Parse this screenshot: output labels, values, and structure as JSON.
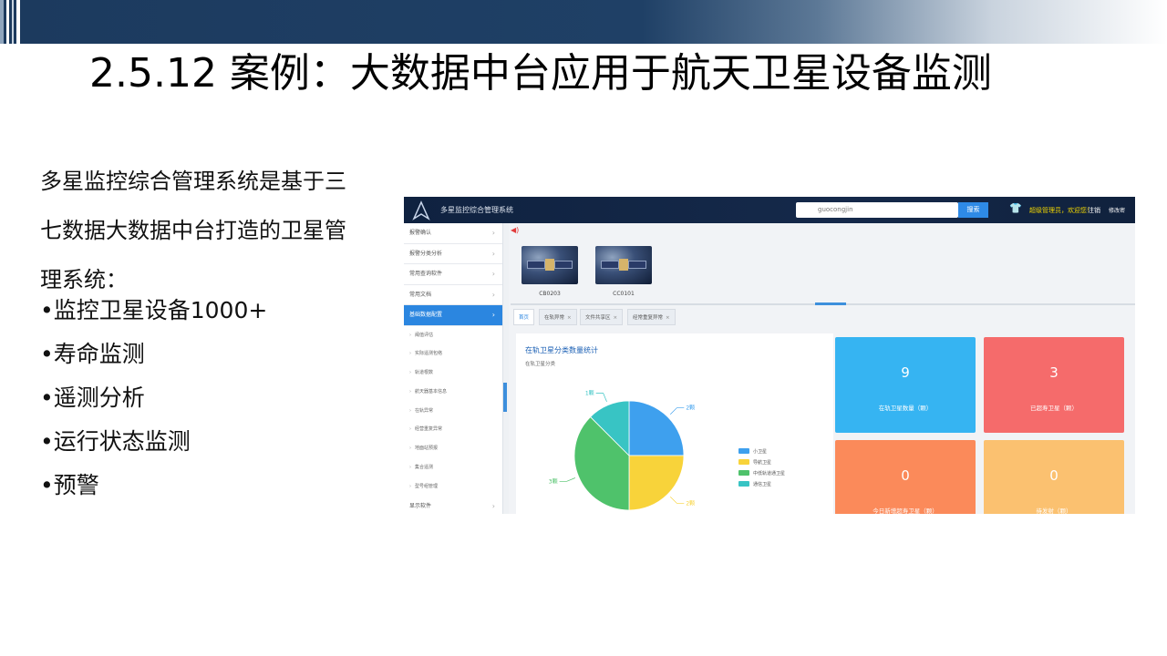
{
  "slide": {
    "title": "2.5.12 案例：大数据中台应用于航天卫星设备监测",
    "intro_lines": [
      "多星监控综合管理系统是基于三",
      "七数据大数据中台打造的卫星管",
      "理系统："
    ],
    "bullets": [
      "•监控卫星设备1000+",
      "•寿命监测",
      "•遥测分析",
      "•运行状态监测",
      "•预警"
    ]
  },
  "app": {
    "name": "多星监控综合管理系统",
    "search": {
      "value": "guocongjin",
      "button": "搜索"
    },
    "welcome": "超级管理员，欢迎您！",
    "logout": "注销",
    "extra": "修改密",
    "sidebar": {
      "items_top": [
        {
          "label": "报警确认"
        },
        {
          "label": "报警分类分析"
        },
        {
          "label": "常用查询软件"
        },
        {
          "label": "常用文档"
        }
      ],
      "active_item": {
        "label": "基础数据配置"
      },
      "sub_items": [
        "阈值评估",
        "实际遥测包络",
        "轨道根数",
        "航天器基本信息",
        "在轨异常",
        "经营重复异常",
        "地面站预报",
        "集合遥测",
        "型号组管理"
      ],
      "items_bottom": [
        {
          "label": "显示软件"
        }
      ]
    },
    "satellites": [
      {
        "label": "CB0203"
      },
      {
        "label": "CC0101"
      }
    ],
    "tabs": [
      {
        "label": "首页",
        "closable": false
      },
      {
        "label": "在轨异常",
        "closable": true
      },
      {
        "label": "文件共享区",
        "closable": true
      },
      {
        "label": "经常重复异常",
        "closable": true
      }
    ],
    "chart_data": {
      "type": "pie",
      "title": "在轨卫星分类数量统计",
      "subtitle": "在轨卫星分类",
      "categories": [
        "小卫星",
        "导航卫星",
        "中低轨道通卫星",
        "通信卫星"
      ],
      "values": [
        2,
        2,
        3,
        1
      ],
      "data_labels": [
        "2颗",
        "2颗",
        "3颗",
        "1颗"
      ],
      "colors": [
        "#3ea0ee",
        "#f8d33a",
        "#4fc26b",
        "#38c4c4"
      ],
      "legend_position": "right"
    },
    "stats": [
      {
        "value": "9",
        "label": "在轨卫星数量（颗）",
        "color": "#36b4f2"
      },
      {
        "value": "3",
        "label": "已超寿卫星（颗）",
        "color": "#f56b6b"
      },
      {
        "value": "0",
        "label": "今日新增超寿卫星（颗）",
        "color": "#fb8a5a"
      },
      {
        "value": "0",
        "label": "待发射（颗）",
        "color": "#fbc170"
      }
    ],
    "colors": {
      "header": "#13264a",
      "accent": "#2b86e0"
    }
  }
}
